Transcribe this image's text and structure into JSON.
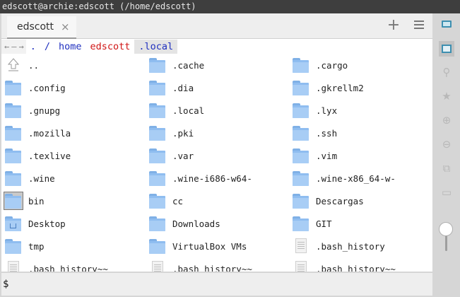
{
  "window": {
    "title": "edscott@archie:edscott (/home/edscott)"
  },
  "tabs": [
    {
      "label": "edscott",
      "close": "×"
    }
  ],
  "tabbar": {
    "add": "+"
  },
  "path": {
    "nav": [
      "←",
      "—",
      "→"
    ],
    "crumbs": [
      ".",
      "/",
      "home",
      "edscott",
      ".local"
    ]
  },
  "files": [
    {
      "name": "..",
      "icon": "updir-icon"
    },
    {
      "name": ".cache",
      "icon": "folder-icon"
    },
    {
      "name": ".cargo",
      "icon": "folder-icon"
    },
    {
      "name": ".config",
      "icon": "folder-icon"
    },
    {
      "name": ".dia",
      "icon": "folder-icon"
    },
    {
      "name": ".gkrellm2",
      "icon": "folder-icon"
    },
    {
      "name": ".gnupg",
      "icon": "folder-icon"
    },
    {
      "name": ".local",
      "icon": "folder-icon"
    },
    {
      "name": ".lyx",
      "icon": "folder-icon"
    },
    {
      "name": ".mozilla",
      "icon": "folder-icon"
    },
    {
      "name": ".pki",
      "icon": "folder-icon"
    },
    {
      "name": ".ssh",
      "icon": "folder-icon"
    },
    {
      "name": ".texlive",
      "icon": "folder-icon"
    },
    {
      "name": ".var",
      "icon": "folder-icon"
    },
    {
      "name": ".vim",
      "icon": "folder-icon"
    },
    {
      "name": ".wine",
      "icon": "folder-icon"
    },
    {
      "name": ".wine-i686-w64-",
      "icon": "folder-icon"
    },
    {
      "name": ".wine-x86_64-w-",
      "icon": "folder-icon"
    },
    {
      "name": "bin",
      "icon": "folder-icon",
      "selected": true
    },
    {
      "name": "cc",
      "icon": "folder-icon"
    },
    {
      "name": "Descargas",
      "icon": "folder-icon"
    },
    {
      "name": "Desktop",
      "icon": "folder-desktop-icon"
    },
    {
      "name": "Downloads",
      "icon": "folder-icon"
    },
    {
      "name": "GIT",
      "icon": "folder-icon"
    },
    {
      "name": "tmp",
      "icon": "folder-icon"
    },
    {
      "name": "VirtualBox VMs",
      "icon": "folder-icon"
    },
    {
      "name": ".bash_history",
      "icon": "text-file-icon"
    },
    {
      "name": ".bash_history~~",
      "icon": "text-file-icon"
    },
    {
      "name": ".bash_history~~",
      "icon": "text-file-icon"
    },
    {
      "name": ".bash_history~~",
      "icon": "text-file-icon"
    }
  ],
  "terminal": {
    "prompt": "$"
  },
  "sidebar": {
    "items": [
      "monitor-icon",
      "home-icon",
      "search-icon",
      "bookmark-icon",
      "zoom-in-icon",
      "zoom-out-icon",
      "copy-icon",
      "terminal-icon"
    ],
    "zoom_level": 0.5
  }
}
